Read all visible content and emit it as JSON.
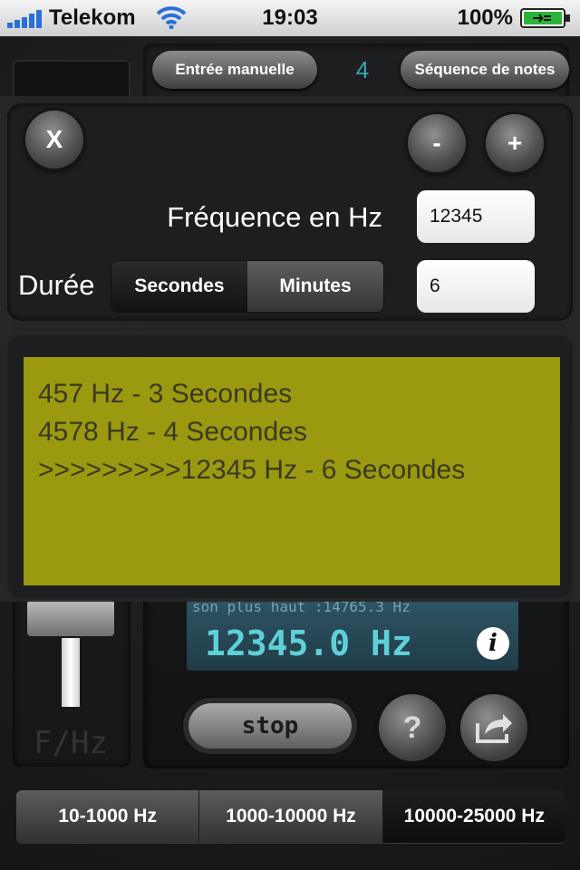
{
  "status_bar": {
    "carrier": "Telekom",
    "time": "19:03",
    "battery": "100%",
    "icons": [
      "signal-icon",
      "wifi-icon",
      "battery-charging-icon"
    ]
  },
  "background_app": {
    "manual_button": "Entrée manuelle",
    "note_count": "4",
    "sequence_button": "Séquence de notes",
    "lcd_line": "son plus haut :14765.3 Hz",
    "lcd_frequency": "12345.0 Hz",
    "info_icon": "i",
    "stop_button": "stop",
    "help_button": "?",
    "slider_label": "F/Hz",
    "ranges": [
      {
        "label": "10-1000 Hz",
        "selected": false
      },
      {
        "label": "1000-10000 Hz",
        "selected": false
      },
      {
        "label": "10000-25000 Hz",
        "selected": true
      }
    ]
  },
  "overlay": {
    "close_button": "X",
    "minus_button": "-",
    "plus_button": "+",
    "frequency_label": "Fréquence en Hz",
    "frequency_value": "12345",
    "duration_label": "Durée",
    "duration_units": [
      {
        "label": "Secondes",
        "selected": true
      },
      {
        "label": "Minutes",
        "selected": false
      }
    ],
    "duration_value": "6",
    "sequence": [
      "457 Hz - 3 Secondes",
      "4578 Hz - 4 Secondes",
      ">>>>>>>>>12345 Hz - 6 Secondes"
    ]
  },
  "colors": {
    "list_background": "#9a9910",
    "lcd_text": "#5fd0d8",
    "accent_count": "#3aa6b4"
  }
}
